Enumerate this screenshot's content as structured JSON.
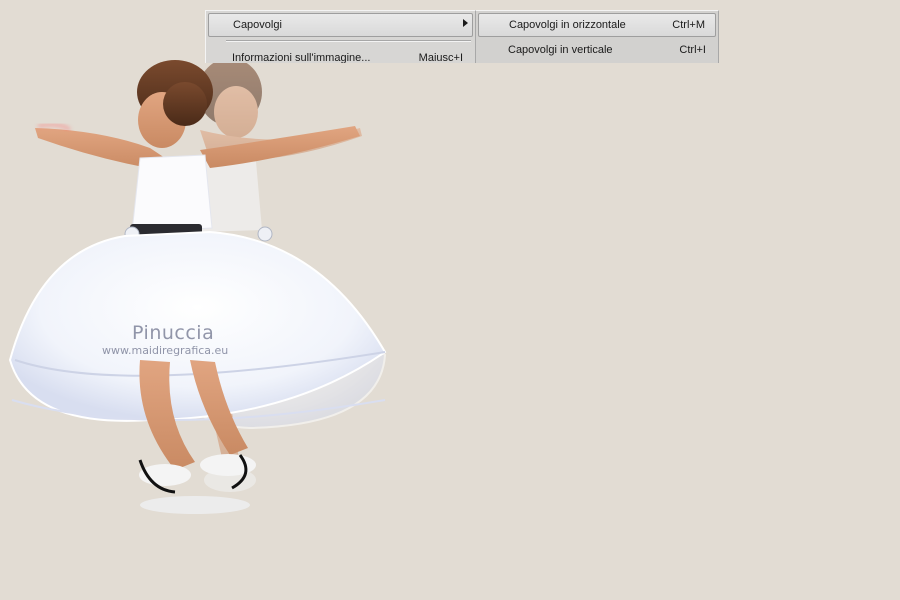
{
  "menu": {
    "items": [
      {
        "label": "Capovolgi",
        "shortcut": "",
        "has_submenu": true
      },
      {
        "label": "Informazioni sull'immagine...",
        "shortcut": "Maiusc+I",
        "has_submenu": false
      }
    ]
  },
  "submenu": {
    "items": [
      {
        "label": "Capovolgi in orizzontale",
        "shortcut": "Ctrl+M"
      },
      {
        "label": "Capovolgi in verticale",
        "shortcut": "Ctrl+I"
      }
    ]
  },
  "watermark": {
    "title": "Pinuccia",
    "url": "www.maidiregrafica.eu"
  },
  "colors": {
    "canvas_bg": "#e2dcd3",
    "menu_bg": "#d7d6d4",
    "highlight_border": "#9e9e9e"
  }
}
